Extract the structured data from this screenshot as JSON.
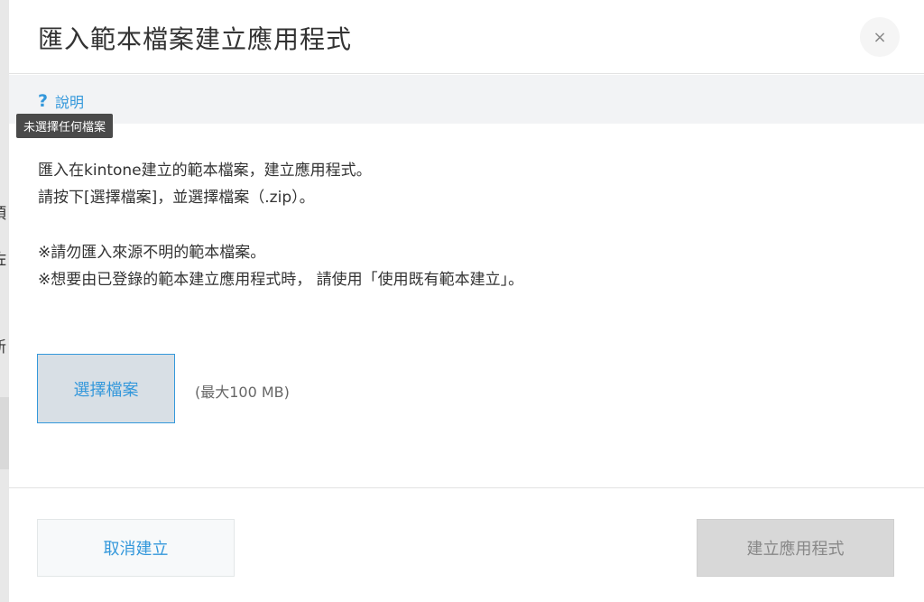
{
  "dialog": {
    "title": "匯入範本檔案建立應用程式",
    "close_label": "×"
  },
  "help": {
    "icon": "?",
    "label": "說明",
    "tooltip": "未選擇任何檔案"
  },
  "content": {
    "line1": "匯入在kintone建立的範本檔案，建立應用程式。",
    "line2": "請按下[選擇檔案]，並選擇檔案（.zip）。",
    "note1": "※請勿匯入來源不明的範本檔案。",
    "note2": "※想要由已登錄的範本建立應用程式時， 請使用「使用既有範本建立」。"
  },
  "file_picker": {
    "button_label": "選擇檔案",
    "max_size": "(最大100 MB)"
  },
  "footer": {
    "cancel_label": "取消建立",
    "create_label": "建立應用程式"
  },
  "background_fragments": [
    "t",
    "項",
    "佐",
    "新"
  ],
  "colors": {
    "accent": "#3498db",
    "help_bar_bg": "#f2f3f5",
    "disabled_button_bg": "#d8d8d8",
    "file_button_bg": "#d8dfe5"
  }
}
